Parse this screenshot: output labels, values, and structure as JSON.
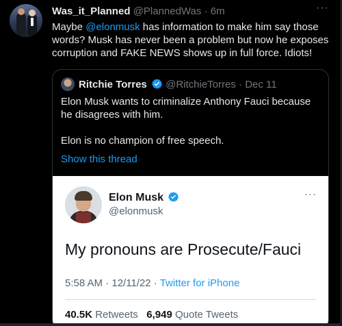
{
  "tweet": {
    "display_name": "Was_it_Planned",
    "handle": "@PlannedWas",
    "separator": "·",
    "time": "6m",
    "more": "···",
    "text_before": "Maybe ",
    "mention": "@elonmusk",
    "text_after": " has information to make him say those words?  Musk has never been a problem but now he exposes corruption and FAKE NEWS shows up in full force. Idiots!"
  },
  "quote": {
    "display_name": "Ritchie Torres",
    "handle": "@RitchieTorres",
    "separator": "·",
    "date": "Dec 11",
    "paragraph1": "Elon Musk wants to criminalize Anthony Fauci because he disagrees with him.",
    "paragraph2": "Elon is no champion of free speech.",
    "show_thread": "Show this thread"
  },
  "screenshot": {
    "display_name": "Elon Musk",
    "handle": "@elonmusk",
    "more": "···",
    "text": "My pronouns are Prosecute/Fauci",
    "time": "5:58 AM · 12/11/22 · ",
    "source": "Twitter for iPhone",
    "retweets_count": "40.5K",
    "retweets_label": "Retweets",
    "quote_count": "6,949",
    "quote_label": "Quote Tweets"
  },
  "colors": {
    "background": "#000000",
    "accent": "#1d9bf0",
    "muted": "#71767b",
    "border": "#2f3336"
  }
}
